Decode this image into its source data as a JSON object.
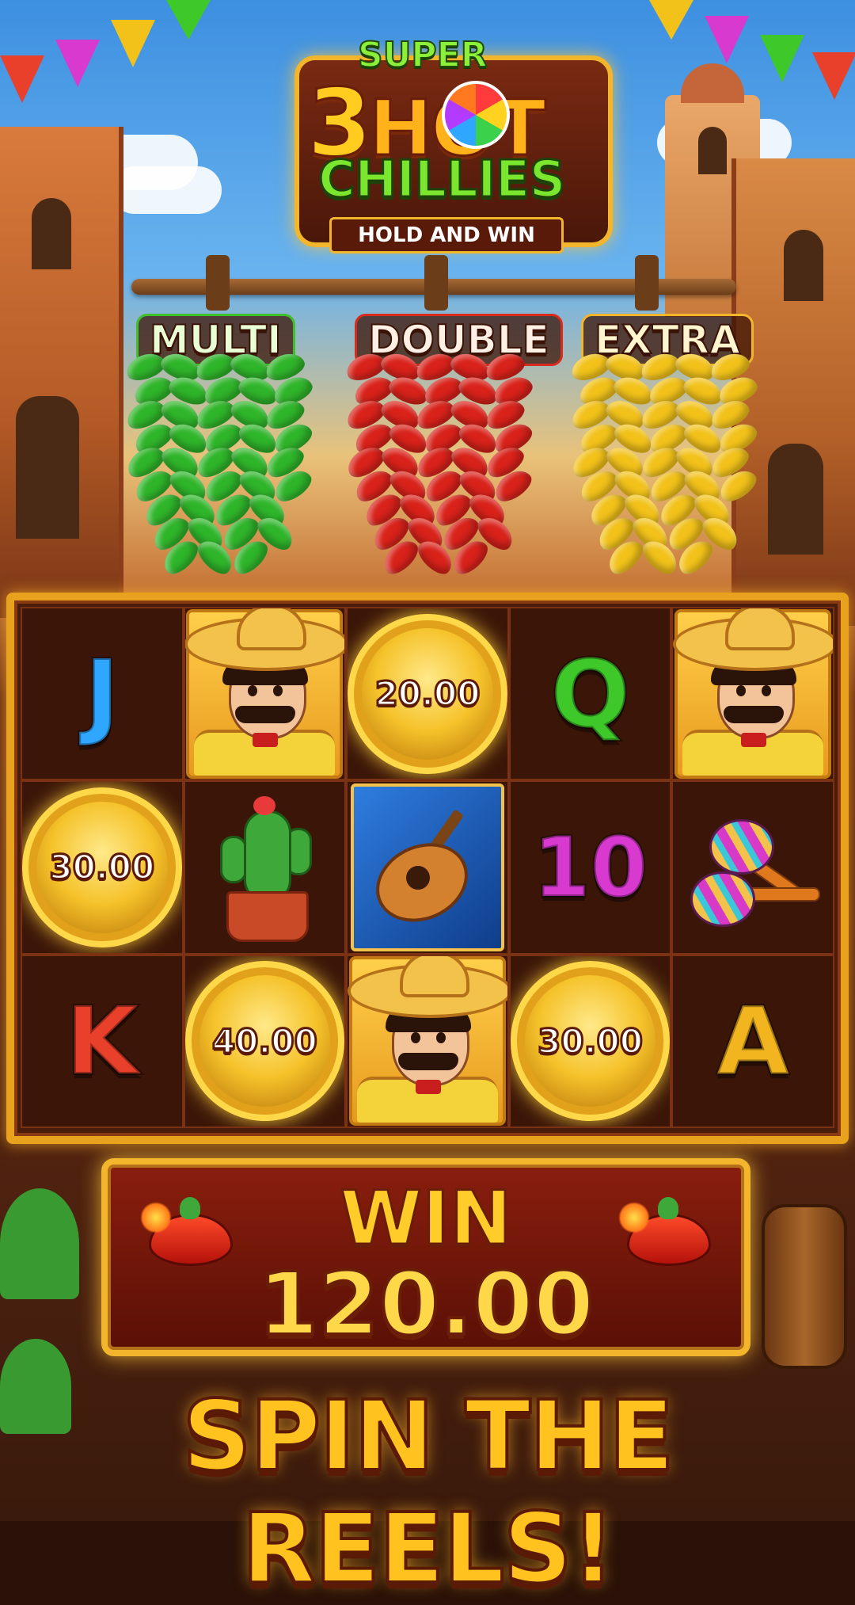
{
  "logo": {
    "super": "SUPER",
    "number": "3",
    "hot": "HOT",
    "chillies": "CHILLIES",
    "tagline": "HOLD AND WIN"
  },
  "peppers": [
    {
      "label": "MULTI",
      "color": "#2fb52a"
    },
    {
      "label": "DOUBLE",
      "color": "#d8221a"
    },
    {
      "label": "EXTRA",
      "color": "#f2c21a"
    }
  ],
  "reels": {
    "row1": [
      {
        "symbol": "J",
        "color": "#2fa6ff"
      },
      {
        "symbol": "mariachi"
      },
      {
        "symbol": "coin",
        "value": "20.00"
      },
      {
        "symbol": "Q",
        "color": "#3fc82a"
      },
      {
        "symbol": "mariachi"
      }
    ],
    "row2": [
      {
        "symbol": "coin",
        "value": "30.00"
      },
      {
        "symbol": "cactus"
      },
      {
        "symbol": "guitar"
      },
      {
        "symbol": "10",
        "color": "#d83ad0"
      },
      {
        "symbol": "maracas"
      }
    ],
    "row3": [
      {
        "symbol": "K",
        "color": "#e8402a"
      },
      {
        "symbol": "coin",
        "value": "40.00"
      },
      {
        "symbol": "mariachi"
      },
      {
        "symbol": "coin",
        "value": "30.00"
      },
      {
        "symbol": "A",
        "color": "#f2b51f"
      }
    ]
  },
  "win": {
    "label": "WIN",
    "amount": "120.00"
  },
  "cta": "SPIN THE REELS!"
}
